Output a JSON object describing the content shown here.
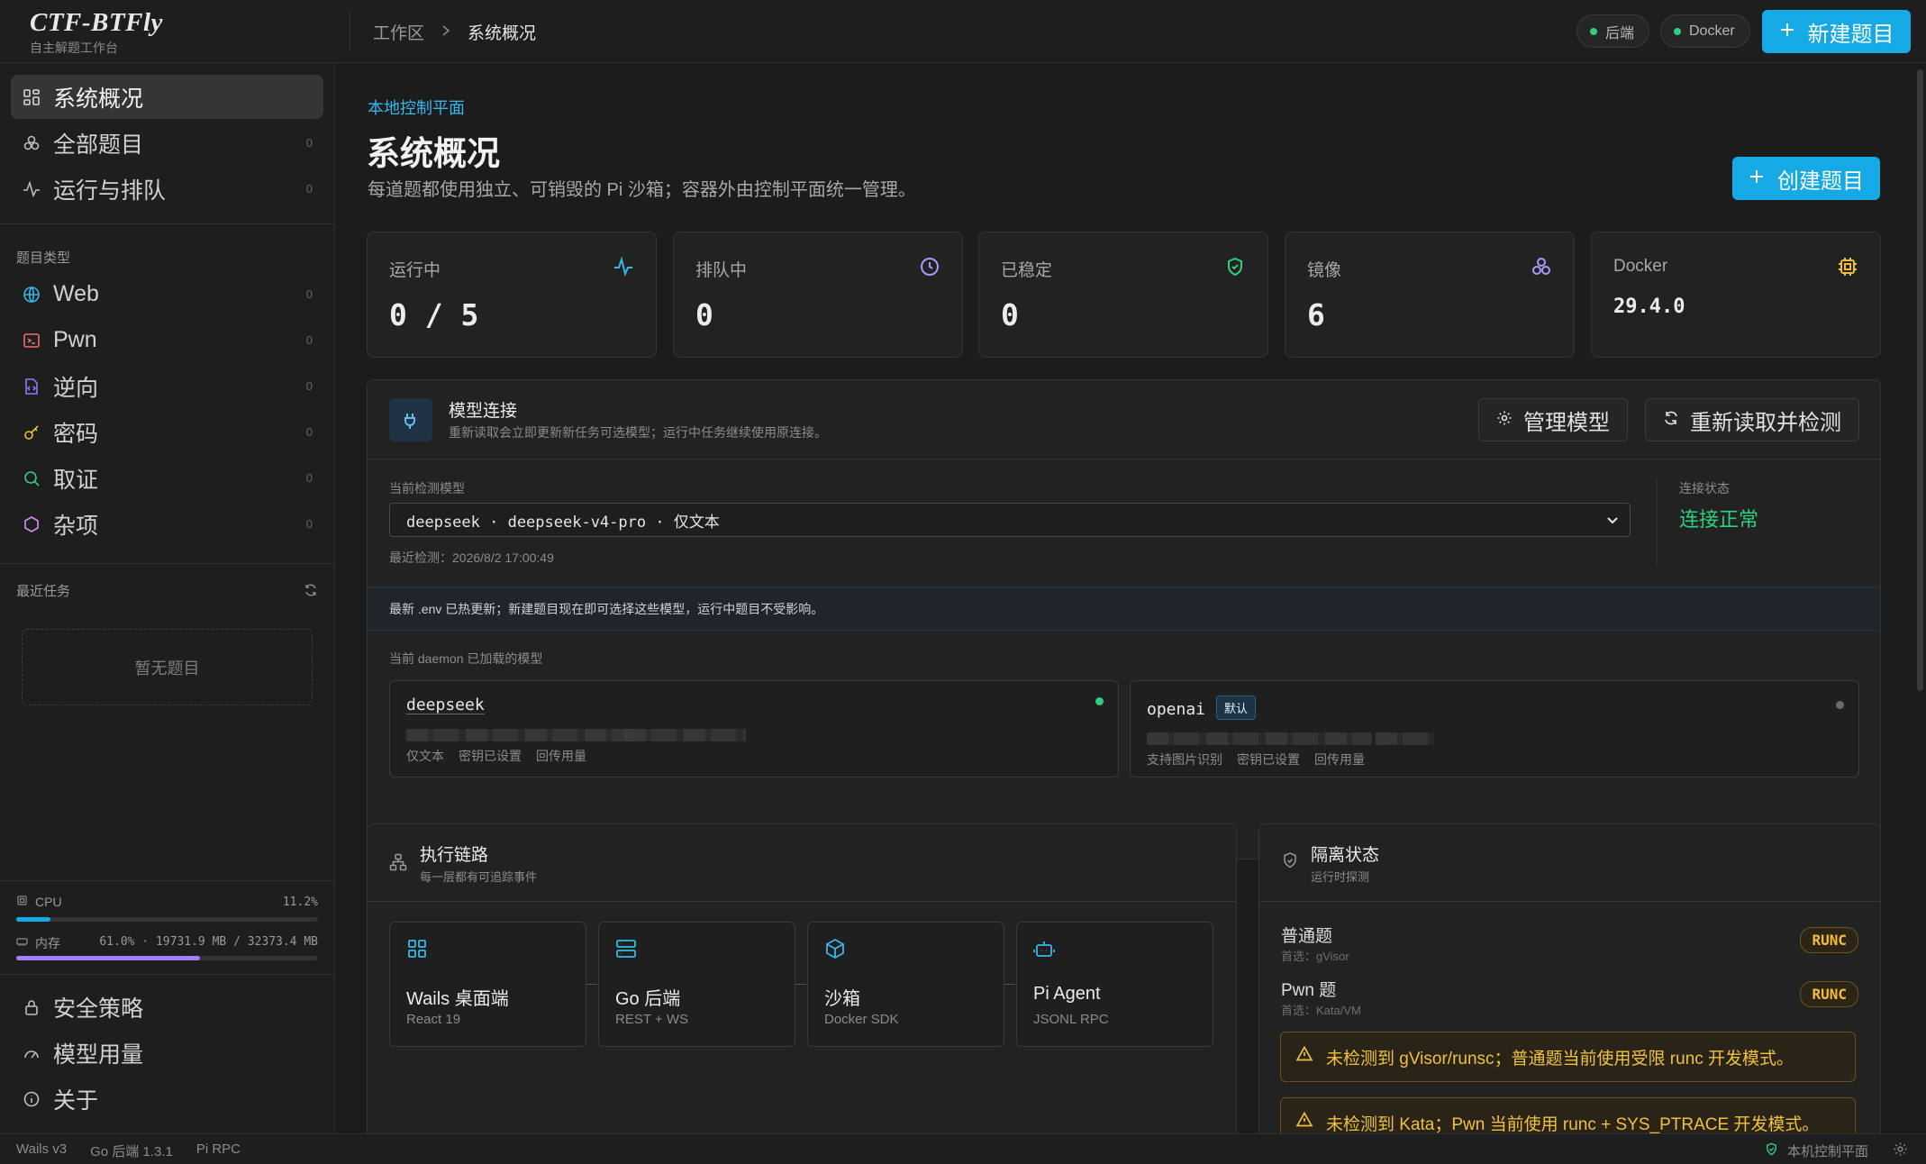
{
  "app": {
    "name": "CTF-BTFly",
    "subtitle": "自主解题工作台"
  },
  "breadcrumb": {
    "root": "工作区",
    "current": "系统概况"
  },
  "top_status": {
    "backend": "后端",
    "docker": "Docker"
  },
  "top_new_button": "新建题目",
  "sidebar": {
    "nav": [
      {
        "label": "系统概况",
        "icon": "dashboard-icon"
      },
      {
        "label": "全部题目",
        "icon": "grid-icon",
        "count": "0"
      },
      {
        "label": "运行与排队",
        "icon": "activity-icon",
        "count": "0"
      }
    ],
    "categories_heading": "题目类型",
    "categories": [
      {
        "label": "Web",
        "icon": "globe-icon",
        "color": "#39b6e8",
        "count": "0"
      },
      {
        "label": "Pwn",
        "icon": "terminal-icon",
        "color": "#ef6b6b",
        "count": "0"
      },
      {
        "label": "逆向",
        "icon": "file-code-icon",
        "color": "#8b7cf6",
        "count": "0"
      },
      {
        "label": "密码",
        "icon": "key-icon",
        "color": "#f2bd3c",
        "count": "0"
      },
      {
        "label": "取证",
        "icon": "search-icon",
        "color": "#2bd17e",
        "count": "0"
      },
      {
        "label": "杂项",
        "icon": "hexagon-icon",
        "color": "#d98cf2",
        "count": "0"
      }
    ],
    "recent_heading": "最近任务",
    "recent_empty": "暂无题目",
    "cpu": {
      "label": "CPU",
      "value": "11.2%",
      "fraction": 0.112
    },
    "mem": {
      "label": "内存",
      "value": "61.0% · 19731.9 MB / 32373.4 MB",
      "fraction": 0.61
    },
    "footer": [
      {
        "label": "安全策略",
        "icon": "lock-icon"
      },
      {
        "label": "模型用量",
        "icon": "gauge-icon"
      },
      {
        "label": "关于",
        "icon": "info-icon"
      }
    ]
  },
  "page": {
    "kicker": "本地控制平面",
    "title": "系统概况",
    "subtitle": "每道题都使用独立、可销毁的 Pi 沙箱；容器外由控制平面统一管理。",
    "create_button": "创建题目"
  },
  "stats": [
    {
      "label": "运行中",
      "value": "0 / 5",
      "icon": "activity-icon",
      "color": "#39b6e8"
    },
    {
      "label": "排队中",
      "value": "0",
      "icon": "clock-icon",
      "color": "#a99af8"
    },
    {
      "label": "已稳定",
      "value": "0",
      "icon": "shield-check-icon",
      "color": "#2bd17e"
    },
    {
      "label": "镜像",
      "value": "6",
      "icon": "layers-icon",
      "color": "#a99af8"
    },
    {
      "label": "Docker",
      "value": "29.4.0",
      "icon": "chip-icon",
      "color": "#f2bd3c"
    }
  ],
  "model_panel": {
    "title": "模型连接",
    "desc": "重新读取会立即更新新任务可选模型；运行中任务继续使用原连接。",
    "manage_button": "管理模型",
    "reload_button": "重新读取并检测",
    "current_label": "当前检测模型",
    "current_value": "deepseek · deepseek-v4-pro · 仅文本",
    "last_check": "最近检测：2026/8/2 17:00:49",
    "conn_label": "连接状态",
    "conn_value": "连接正常",
    "notice": "最新 .env 已热更新；新建题目现在即可选择这些模型，运行中题目不受影响。",
    "loaded_label": "当前 daemon 已加载的模型",
    "models": [
      {
        "name": "deepseek",
        "tags": [
          "仅文本",
          "密钥已设置",
          "回传用量"
        ],
        "status_color": "#2bd17e"
      },
      {
        "name": "openai",
        "badge": "默认",
        "tags": [
          "支持图片识别",
          "密钥已设置",
          "回传用量"
        ],
        "status_color": "#6b6b6b"
      }
    ]
  },
  "chain": {
    "title": "执行链路",
    "desc": "每一层都有可追踪事件",
    "steps": [
      {
        "title": "Wails 桌面端",
        "sub": "React 19",
        "icon": "grid-icon"
      },
      {
        "title": "Go 后端",
        "sub": "REST + WS",
        "icon": "server-icon"
      },
      {
        "title": "沙箱",
        "sub": "Docker SDK",
        "icon": "box-icon"
      },
      {
        "title": "Pi Agent",
        "sub": "JSONL RPC",
        "icon": "bot-icon"
      }
    ]
  },
  "isolation": {
    "title": "隔离状态",
    "desc": "运行时探测",
    "rows": [
      {
        "title": "普通题",
        "sub": "首选：gVisor",
        "badge": "RUNC"
      },
      {
        "title": "Pwn 题",
        "sub": "首选：Kata/VM",
        "badge": "RUNC"
      }
    ],
    "warnings": [
      "未检测到 gVisor/runsc；普通题当前使用受限 runc 开发模式。",
      "未检测到 Kata；Pwn 当前使用 runc + SYS_PTRACE 开发模式。"
    ]
  },
  "statusbar": {
    "left": [
      "Wails v3",
      "Go 后端 1.3.1",
      "Pi RPC"
    ],
    "right": "本机控制平面"
  }
}
